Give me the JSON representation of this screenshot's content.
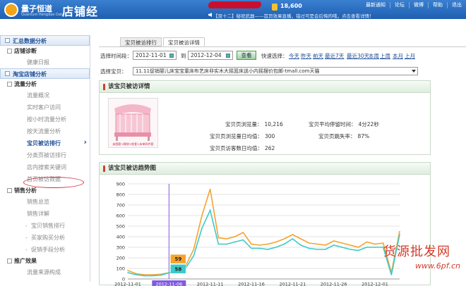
{
  "header": {
    "brand": "量子恒道",
    "brand_sub": "Quantum Hengdao Data",
    "product": "店铺经",
    "coins": "18,600",
    "ticker": "【双十二】秘密武器——首页效果直播，错过可是会后悔的哦，点击查看详情！",
    "links": [
      "最新通知",
      "论坛",
      "微博",
      "帮助",
      "退出"
    ]
  },
  "sidebar": {
    "sections": [
      {
        "title": "汇总数据分析",
        "groups": [
          {
            "title": "店铺诊断",
            "items": [
              "健康日报"
            ]
          }
        ]
      },
      {
        "title": "淘宝店铺分析",
        "groups": [
          {
            "title": "流量分析",
            "items": [
              "流量概况",
              "实时客户访问",
              "按小时流量分析",
              "按天流量分析",
              "宝贝被访排行",
              "分类页被访排行",
              "店内搜索关键词",
              "首页被访数据"
            ]
          },
          {
            "title": "销售分析",
            "items": [
              "销售总览",
              "销售详解",
              "宝贝销售排行",
              "买家购买分析",
              "促销手段分析"
            ]
          },
          {
            "title": "推广效果",
            "items": [
              "流量来源构成"
            ]
          }
        ]
      }
    ],
    "active_item": "宝贝被访排行"
  },
  "tabs": [
    "宝贝被访排行",
    "宝贝被访详情"
  ],
  "active_tab": "宝贝被访详情",
  "filter": {
    "time_label": "选择时间段：",
    "from": "2012-11-01",
    "to_label": "到",
    "to": "2012-12-04",
    "view_button": "查看",
    "quick_label": "快速选择：",
    "quick": [
      "今天",
      "昨天",
      "前天",
      "最近7天",
      "最近30天",
      "本周",
      "上周",
      "本月",
      "上月"
    ]
  },
  "product_select": {
    "label": "选择宝贝：",
    "value": "11.11促销婴儿床宝宝童床布艺床非实木大摇篮床送小内摇摆价包邮-tmall.com天猫"
  },
  "detail_panel": {
    "title": "该宝贝被访详情",
    "image_caption": "床围套+睡袋+枕套+床单四件套",
    "stats": [
      {
        "label": "宝贝页浏览量：",
        "value": "10,216"
      },
      {
        "label": "宝贝平均停留时间：",
        "value": "4分22秒"
      },
      {
        "label": "宝贝页浏览量日均值：",
        "value": "300"
      },
      {
        "label": "宝贝页跳失率：",
        "value": "87%"
      },
      {
        "label": "宝贝页访客数日均值：",
        "value": "262"
      }
    ]
  },
  "trend_panel": {
    "title": "该宝贝被访趋势图"
  },
  "chart_data": {
    "type": "line",
    "title": "",
    "ylim": [
      0,
      900
    ],
    "yticks": [
      0,
      100,
      200,
      300,
      400,
      500,
      600,
      700,
      800,
      900
    ],
    "x": [
      "2012-11-01",
      "2012-11-02",
      "2012-11-03",
      "2012-11-04",
      "2012-11-05",
      "2012-11-06",
      "2012-11-07",
      "2012-11-08",
      "2012-11-09",
      "2012-11-10",
      "2012-11-11",
      "2012-11-12",
      "2012-11-13",
      "2012-11-14",
      "2012-11-15",
      "2012-11-16",
      "2012-11-17",
      "2012-11-18",
      "2012-11-19",
      "2012-11-20",
      "2012-11-21",
      "2012-11-22",
      "2012-11-23",
      "2012-11-24",
      "2012-11-25",
      "2012-11-26",
      "2012-11-27",
      "2012-11-28",
      "2012-11-29",
      "2012-11-30",
      "2012-12-01",
      "2012-12-02",
      "2012-12-03",
      "2012-12-04"
    ],
    "xtick_labels": [
      "2012-11-01",
      "2012-11-06",
      "2012-11-11",
      "2012-11-16",
      "2012-11-21",
      "2012-11-26",
      "2012-12-01"
    ],
    "series": [
      {
        "values": [
          80,
          50,
          40,
          40,
          45,
          59,
          70,
          120,
          280,
          600,
          850,
          390,
          380,
          400,
          440,
          330,
          320,
          330,
          350,
          380,
          420,
          380,
          340,
          330,
          320,
          360,
          340,
          320,
          300,
          350,
          330,
          340,
          60,
          450
        ],
        "color": "#f5a330"
      },
      {
        "values": [
          60,
          40,
          30,
          30,
          35,
          58,
          60,
          100,
          220,
          480,
          650,
          330,
          330,
          350,
          370,
          290,
          290,
          280,
          300,
          330,
          380,
          320,
          290,
          280,
          280,
          320,
          300,
          280,
          270,
          300,
          300,
          300,
          40,
          420
        ],
        "color": "#3ec9c9"
      }
    ],
    "highlight": {
      "x": "2012-11-06",
      "labels": [
        "59",
        "58"
      ]
    }
  },
  "watermark": {
    "text": "货源批发网",
    "url": "www.6pf.cn"
  },
  "colors": {
    "header_blue": "#2a6cc4",
    "accent_red": "#d2402e",
    "pv_orange": "#f5a330",
    "uv_cyan": "#3ec9c9",
    "highlight_purple": "#7f5be0"
  }
}
